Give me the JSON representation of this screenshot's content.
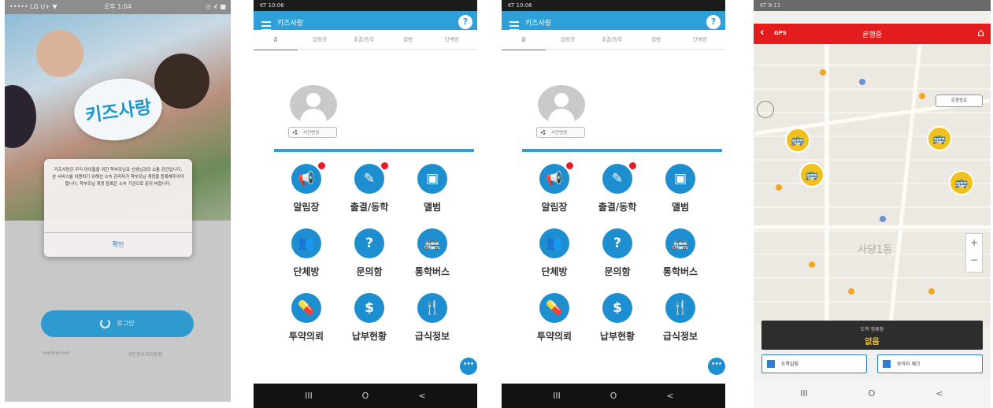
{
  "login": {
    "status_left": "••••• LG U+ ▼",
    "status_center": "오후 1:04",
    "status_right": "⊙ ⊀ ■",
    "logo_text": "키즈사랑",
    "dialog_message": "키즈사랑은 우리 아이들을 위한 학부모님과 선생님과의 소통 공간입니다. 본 서비스를 이용하기 위해선 소속 관리자가 학부모님 계정을 등록해주어야 합니다. 학부모님 계정 등록은 소속 기관으로 문의 바랍니다.",
    "dialog_ok": "확인",
    "login_button": "로그인",
    "link_left": "mellowcom",
    "link_right": "개인정보처리방침"
  },
  "menu": {
    "status": "KT 10:06",
    "app_title": "키즈사랑",
    "help_icon": "?",
    "tabs": [
      "홈",
      "알림장",
      "출결/동학",
      "앨범",
      "단체방"
    ],
    "settings_label": "사진변경",
    "items": [
      {
        "label": "알림장",
        "icon": "megaphone-icon",
        "glyph": "📢",
        "badge": true
      },
      {
        "label": "출결/동학",
        "icon": "attendance-icon",
        "glyph": "✎",
        "badge": true
      },
      {
        "label": "앨범",
        "icon": "photo-album-icon",
        "glyph": "▣",
        "badge": false
      },
      {
        "label": "단체방",
        "icon": "group-chat-icon",
        "glyph": "👥",
        "badge": false
      },
      {
        "label": "문의함",
        "icon": "question-icon",
        "glyph": "?",
        "badge": false
      },
      {
        "label": "통학버스",
        "icon": "bus-icon",
        "glyph": "🚌",
        "badge": false
      },
      {
        "label": "투약의뢰",
        "icon": "pill-icon",
        "glyph": "💊",
        "badge": false
      },
      {
        "label": "납부현황",
        "icon": "dollar-icon",
        "glyph": "$",
        "badge": false
      },
      {
        "label": "급식정보",
        "icon": "meal-icon",
        "glyph": "🍴",
        "badge": false
      }
    ],
    "more_icon": "⋯",
    "nav": [
      "III",
      "O",
      "<"
    ]
  },
  "map": {
    "status": "KT 9:11",
    "gps_label": "GPS",
    "title": "운행중",
    "op_button": "운행종료",
    "district": "사당1동",
    "panel_title": "도착 정류장",
    "panel_value": "없음",
    "btn_left": "도착알림",
    "btn_right": "승하차 체크",
    "nav": [
      "III",
      "O",
      "<"
    ],
    "colors": {
      "appbar": "#e31d1d",
      "bus": "#f2c21c"
    }
  }
}
